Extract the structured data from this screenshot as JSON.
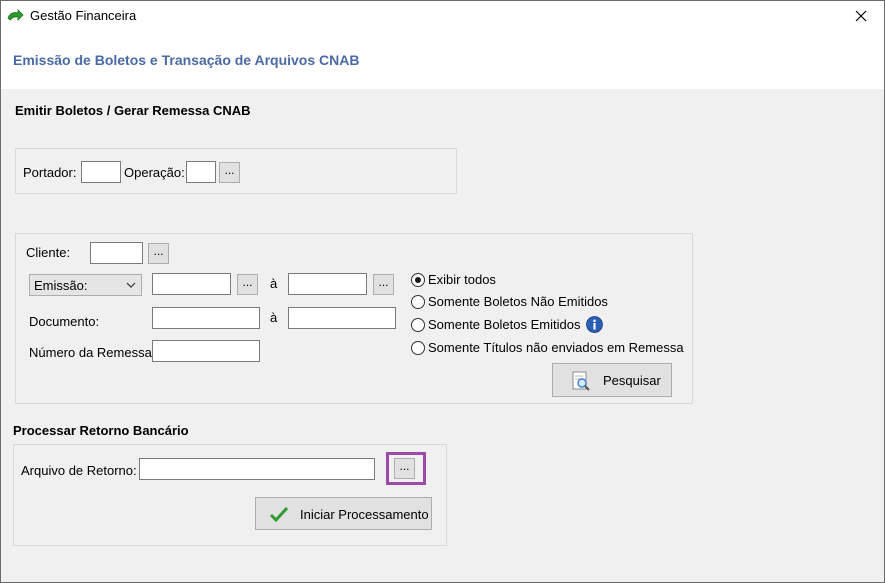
{
  "window": {
    "title": "Gestão Financeira"
  },
  "header": {
    "title": "Emissão de Boletos e Transação de Arquivos CNAB"
  },
  "emitir": {
    "section_title": "Emitir Boletos / Gerar Remessa CNAB",
    "portador_label": "Portador:",
    "portador_value": "",
    "operacao_label": "Operação:",
    "operacao_value": "",
    "lookup_label": "..."
  },
  "filtros": {
    "cliente_label": "Cliente:",
    "cliente_value": "",
    "date_type_selected": "Emissão:",
    "date_from": "",
    "date_to": "",
    "a_label": "à",
    "documento_label": "Documento:",
    "documento_from": "",
    "documento_to": "",
    "numero_remessa_label": "Número da Remessa:",
    "numero_remessa_value": "",
    "radio_options": [
      {
        "label": "Exibir todos",
        "selected": true
      },
      {
        "label": "Somente Boletos Não Emitidos",
        "selected": false
      },
      {
        "label": "Somente Boletos Emitidos",
        "selected": false
      },
      {
        "label": "Somente Títulos não enviados em Remessa",
        "selected": false
      }
    ],
    "pesquisar_label": "Pesquisar",
    "lookup_label": "..."
  },
  "retorno": {
    "section_title": "Processar Retorno Bancário",
    "arquivo_label": "Arquivo de Retorno:",
    "arquivo_value": "",
    "lookup_label": "...",
    "iniciar_label": "Iniciar Processamento"
  },
  "colors": {
    "header_title": "#4a6aa5",
    "highlight": "#9b4aa8",
    "panel_bg": "#f0f0f0",
    "check_green": "#2e9b2e",
    "info_blue": "#2a5fb3"
  },
  "icons": {
    "app": "green-arrow-icon",
    "close": "close-icon",
    "select": "chevron-down-icon",
    "info": "info-icon",
    "search": "search-document-icon",
    "check": "check-icon"
  }
}
